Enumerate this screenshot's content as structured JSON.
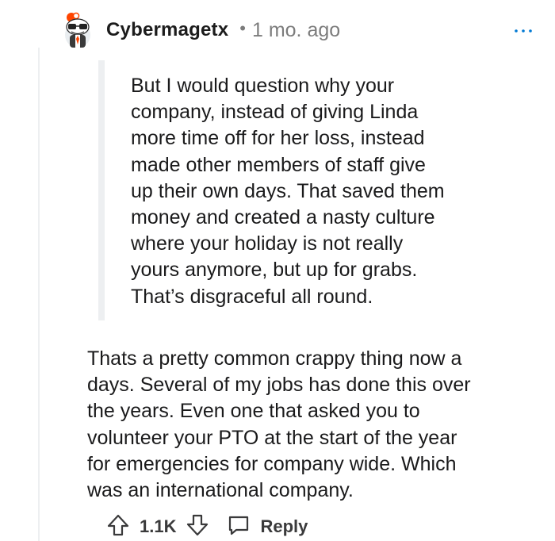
{
  "comment": {
    "author": "Cybermagetx",
    "separator": "•",
    "timestamp": "1 mo. ago",
    "quote": "But I would question why your\ncompany, instead of giving Linda\nmore time off for her loss, instead\nmade other members of staff give\nup their own days. That saved them\nmoney and created a nasty culture\nwhere your holiday is not really\nyours anymore, but up for grabs.\nThat’s disgraceful all round.",
    "body": "Thats a pretty common crappy thing now a\ndays. Several of my jobs has done this over\nthe years. Even one that asked you to\nvolunteer your PTO at the start of the year\nfor emergencies for company wide. Which\nwas an international company.",
    "vote_count": "1.1K",
    "reply_label": "Reply"
  },
  "icons": {
    "avatar": "snoo-avatar-icon",
    "more": "more-options-icon",
    "upvote": "upvote-arrow-icon",
    "downvote": "downvote-arrow-icon",
    "reply": "speech-bubble-icon"
  },
  "colors": {
    "thread_line": "#edeff1",
    "meta_text": "#7c7c7c",
    "more_icon": "#0079d3",
    "avatar_accent": "#ff4500"
  }
}
